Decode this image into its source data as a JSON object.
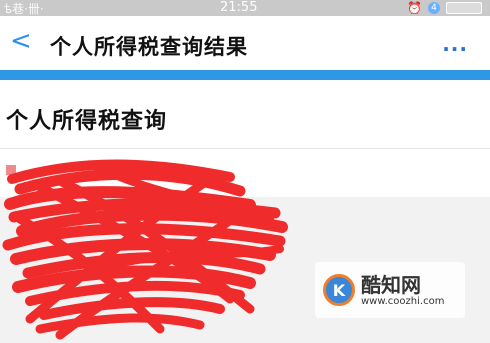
{
  "status_bar": {
    "carrier": "ѣ巷·卌·",
    "time": "21:55",
    "badge_number": "4"
  },
  "app_bar": {
    "back_glyph": "<",
    "title": "个人所得税查询结果",
    "more_glyph": "..."
  },
  "section": {
    "title": "个人所得税查询"
  },
  "watermark": {
    "name": "酷知网",
    "url": "www.coozhi.com"
  },
  "colors": {
    "accent_blue": "#2f98e6",
    "redaction_red": "#f02b2b"
  }
}
